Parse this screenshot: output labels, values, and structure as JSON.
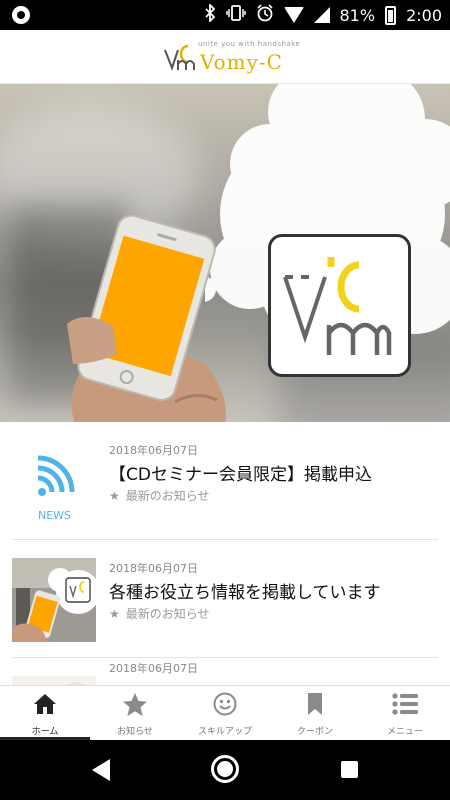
{
  "status_bar": {
    "battery_percent": "81%",
    "time": "2:00"
  },
  "header": {
    "tagline": "unite you with handshake",
    "brand": "Vomy-C",
    "logo_accent": "#e0b000"
  },
  "hero": {
    "phone_screen_color": "#ffa500"
  },
  "news": {
    "items": [
      {
        "date": "2018年06月07日",
        "title": "【CDセミナー会員限定】掲載申込",
        "category": "最新のお知らせ",
        "thumb_label": "NEWS",
        "thumb_icon": "rss-icon"
      },
      {
        "date": "2018年06月07日",
        "title": "各種お役立ち情報を掲載しています",
        "category": "最新のお知らせ",
        "thumb_icon": "photo-thumbnail"
      },
      {
        "date": "2018年06月07日"
      }
    ]
  },
  "bottom_nav": {
    "items": [
      {
        "label": "ホーム",
        "icon": "home-icon",
        "active": true
      },
      {
        "label": "お知らせ",
        "icon": "star-icon",
        "active": false
      },
      {
        "label": "スキルアップ",
        "icon": "smiley-icon",
        "active": false
      },
      {
        "label": "クーポン",
        "icon": "bookmark-icon",
        "active": false
      },
      {
        "label": "メニュー",
        "icon": "list-icon",
        "active": false
      }
    ]
  },
  "colors": {
    "accent": "#e0b000",
    "rss_blue": "#4fb3e6"
  }
}
